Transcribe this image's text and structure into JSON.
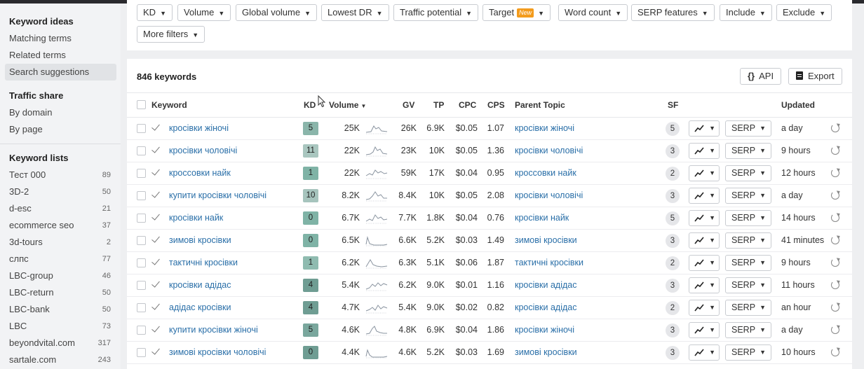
{
  "sidebar": {
    "sections": [
      {
        "title": "Keyword ideas",
        "items": [
          {
            "label": "Matching terms"
          },
          {
            "label": "Related terms"
          },
          {
            "label": "Search suggestions",
            "active": true
          }
        ]
      },
      {
        "title": "Traffic share",
        "items": [
          {
            "label": "By domain"
          },
          {
            "label": "By page"
          }
        ]
      }
    ],
    "lists_title": "Keyword lists",
    "lists": [
      {
        "label": "Тест 000",
        "count": "89"
      },
      {
        "label": "3D-2",
        "count": "50"
      },
      {
        "label": "d-esc",
        "count": "21"
      },
      {
        "label": "ecommerce seo",
        "count": "37"
      },
      {
        "label": "3d-tours",
        "count": "2"
      },
      {
        "label": "слпс",
        "count": "77"
      },
      {
        "label": "LBC-group",
        "count": "46"
      },
      {
        "label": "LBC-return",
        "count": "50"
      },
      {
        "label": "LBC-bank",
        "count": "50"
      },
      {
        "label": "LBC",
        "count": "73"
      },
      {
        "label": "beyondvital.com",
        "count": "317"
      },
      {
        "label": "sartale.com",
        "count": "243"
      }
    ]
  },
  "filters": {
    "kd": "KD",
    "volume": "Volume",
    "global_volume": "Global volume",
    "lowest_dr": "Lowest DR",
    "traffic_potential": "Traffic potential",
    "target": "Target",
    "target_badge": "New",
    "word_count": "Word count",
    "serp_features": "SERP features",
    "include": "Include",
    "exclude": "Exclude",
    "more_filters": "More filters"
  },
  "results": {
    "count_label": "846 keywords",
    "api_label": "API",
    "api_icon": "{}",
    "export_label": "Export"
  },
  "columns": {
    "keyword": "Keyword",
    "kd": "KD",
    "volume": "Volume",
    "gv": "GV",
    "tp": "TP",
    "cpc": "CPC",
    "cps": "CPS",
    "parent_topic": "Parent Topic",
    "sf": "SF",
    "updated": "Updated"
  },
  "rows": [
    {
      "keyword": "кросівки жіночі",
      "kd": "5",
      "volume": "25K",
      "gv": "26K",
      "tp": "6.9K",
      "cpc": "$0.05",
      "cps": "1.07",
      "parent": "кросівки жіночі",
      "sf": "5",
      "serp": "SERP",
      "updated": "a day",
      "kd_color": "#8ab5aa"
    },
    {
      "keyword": "кросівки чоловічі",
      "kd": "11",
      "volume": "22K",
      "gv": "23K",
      "tp": "10K",
      "cpc": "$0.05",
      "cps": "1.36",
      "parent": "кросівки чоловічі",
      "sf": "3",
      "serp": "SERP",
      "updated": "9 hours",
      "kd_color": "#a9c6bf"
    },
    {
      "keyword": "кроссовки найк",
      "kd": "1",
      "volume": "22K",
      "gv": "59K",
      "tp": "17K",
      "cpc": "$0.04",
      "cps": "0.95",
      "parent": "кроссовки найк",
      "sf": "2",
      "serp": "SERP",
      "updated": "12 hours",
      "kd_color": "#7fb3a6"
    },
    {
      "keyword": "купити кросівки чоловічі",
      "kd": "10",
      "volume": "8.2K",
      "gv": "8.4K",
      "tp": "10K",
      "cpc": "$0.05",
      "cps": "2.08",
      "parent": "кросівки чоловічі",
      "sf": "3",
      "serp": "SERP",
      "updated": "a day",
      "kd_color": "#a6c4bd"
    },
    {
      "keyword": "кросівки найк",
      "kd": "0",
      "volume": "6.7K",
      "gv": "7.7K",
      "tp": "1.8K",
      "cpc": "$0.04",
      "cps": "0.76",
      "parent": "кросівки найк",
      "sf": "5",
      "serp": "SERP",
      "updated": "14 hours",
      "kd_color": "#7fb3a6"
    },
    {
      "keyword": "зимові кросівки",
      "kd": "0",
      "volume": "6.5K",
      "gv": "6.6K",
      "tp": "5.2K",
      "cpc": "$0.03",
      "cps": "1.49",
      "parent": "зимові кросівки",
      "sf": "3",
      "serp": "SERP",
      "updated": "41 minutes",
      "kd_color": "#7fb3a6"
    },
    {
      "keyword": "тактичні кросівки",
      "kd": "1",
      "volume": "6.2K",
      "gv": "6.3K",
      "tp": "5.1K",
      "cpc": "$0.06",
      "cps": "1.87",
      "parent": "тактичні кросівки",
      "sf": "2",
      "serp": "SERP",
      "updated": "9 hours",
      "kd_color": "#8fbbb0"
    },
    {
      "keyword": "кросівки адідас",
      "kd": "4",
      "volume": "5.4K",
      "gv": "6.2K",
      "tp": "9.0K",
      "cpc": "$0.01",
      "cps": "1.16",
      "parent": "кросівки адідас",
      "sf": "3",
      "serp": "SERP",
      "updated": "11 hours",
      "kd_color": "#6f9d93"
    },
    {
      "keyword": "адідас кросівки",
      "kd": "4",
      "volume": "4.7K",
      "gv": "5.4K",
      "tp": "9.0K",
      "cpc": "$0.02",
      "cps": "0.82",
      "parent": "кросівки адідас",
      "sf": "2",
      "serp": "SERP",
      "updated": "an hour",
      "kd_color": "#6f9d93"
    },
    {
      "keyword": "купити кросівки жіночі",
      "kd": "5",
      "volume": "4.6K",
      "gv": "4.8K",
      "tp": "6.9K",
      "cpc": "$0.04",
      "cps": "1.86",
      "parent": "кросівки жіночі",
      "sf": "3",
      "serp": "SERP",
      "updated": "a day",
      "kd_color": "#7aa79d"
    },
    {
      "keyword": "зимові кросівки чоловічі",
      "kd": "0",
      "volume": "4.4K",
      "gv": "4.6K",
      "tp": "5.2K",
      "cpc": "$0.03",
      "cps": "1.69",
      "parent": "зимові кросівки",
      "sf": "3",
      "serp": "SERP",
      "updated": "10 hours",
      "kd_color": "#6f9d93"
    }
  ]
}
